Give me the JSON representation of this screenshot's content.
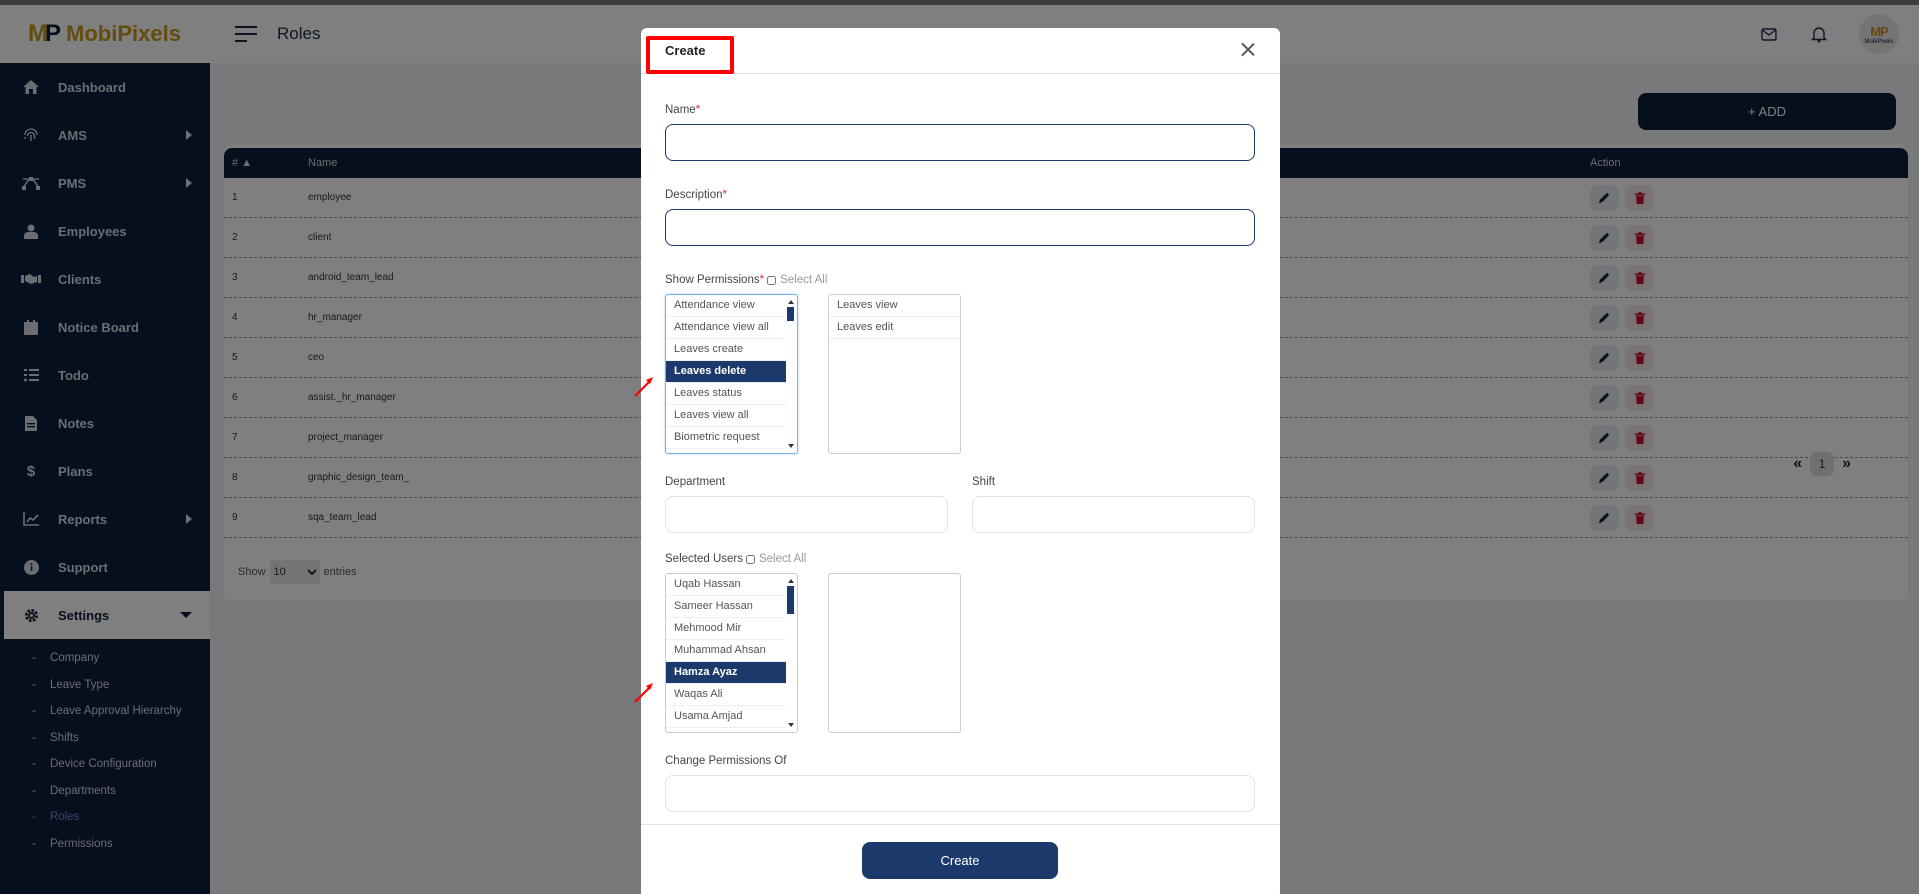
{
  "brand": {
    "name": "MobiPixels",
    "mark": "MP"
  },
  "header": {
    "title": "Roles",
    "avatar_text": "MobiPixels"
  },
  "sidebar": {
    "items": [
      {
        "label": "Dashboard",
        "icon": "home-icon",
        "has_arrow": false
      },
      {
        "label": "AMS",
        "icon": "fingerprint-icon",
        "has_arrow": true
      },
      {
        "label": "PMS",
        "icon": "bezier-icon",
        "has_arrow": true
      },
      {
        "label": "Employees",
        "icon": "user-icon",
        "has_arrow": false
      },
      {
        "label": "Clients",
        "icon": "handshake-icon",
        "has_arrow": false
      },
      {
        "label": "Notice Board",
        "icon": "calendar-icon",
        "has_arrow": false
      },
      {
        "label": "Todo",
        "icon": "tasks-icon",
        "has_arrow": false
      },
      {
        "label": "Notes",
        "icon": "file-icon",
        "has_arrow": false
      },
      {
        "label": "Plans",
        "icon": "dollar-icon",
        "has_arrow": false
      },
      {
        "label": "Reports",
        "icon": "chart-line-icon",
        "has_arrow": true
      },
      {
        "label": "Support",
        "icon": "info-icon",
        "has_arrow": false
      },
      {
        "label": "Settings",
        "icon": "gear-icon",
        "expanded": true
      }
    ],
    "settings_sub": [
      "Company",
      "Leave Type",
      "Leave Approval Hierarchy",
      "Shifts",
      "Device Configuration",
      "Departments",
      "Roles",
      "Permissions"
    ],
    "current_sub": "Roles"
  },
  "main": {
    "add_label": "+ ADD",
    "table": {
      "columns": [
        "#",
        "Name",
        "Action"
      ],
      "rows": [
        {
          "num": "1",
          "name": "employee"
        },
        {
          "num": "2",
          "name": "client"
        },
        {
          "num": "3",
          "name": "android_team_lead"
        },
        {
          "num": "4",
          "name": "hr_manager"
        },
        {
          "num": "5",
          "name": "ceo"
        },
        {
          "num": "6",
          "name": "assist._hr_manager"
        },
        {
          "num": "7",
          "name": "project_manager"
        },
        {
          "num": "8",
          "name": "graphic_design_team_"
        },
        {
          "num": "9",
          "name": "sqa_team_lead"
        }
      ]
    },
    "show_label": "Show",
    "entries_value": "10",
    "entries_label": "entries",
    "pagination": {
      "current": "1"
    }
  },
  "modal": {
    "title": "Create",
    "name_label": "Name",
    "description_label": "Description",
    "required_mark": "*",
    "permissions_label": "Show Permissions",
    "select_all_label": "Select All",
    "available_permissions": [
      "Attendance view",
      "Attendance view all",
      "Leaves create",
      "Leaves delete",
      "Leaves status",
      "Leaves view all",
      "Biometric request"
    ],
    "selected_permission_highlight": "Leaves delete",
    "chosen_permissions": [
      "Leaves view",
      "Leaves edit"
    ],
    "department_label": "Department",
    "shift_label": "Shift",
    "users_label": "Selected Users",
    "available_users": [
      "Uqab Hassan",
      "Sameer Hassan",
      "Mehmood Mir",
      "Muhammad Ahsan",
      "Hamza Ayaz",
      "Waqas Ali",
      "Usama Amjad"
    ],
    "selected_user_highlight": "Hamza Ayaz",
    "chosen_users": [],
    "change_permissions_label": "Change Permissions Of",
    "create_label": "Create"
  },
  "colors": {
    "navy": "#0d1f3c",
    "accent": "#1b3a6b",
    "gold": "#c8961c",
    "danger": "#c8102e",
    "annotation": "#ff0000"
  }
}
